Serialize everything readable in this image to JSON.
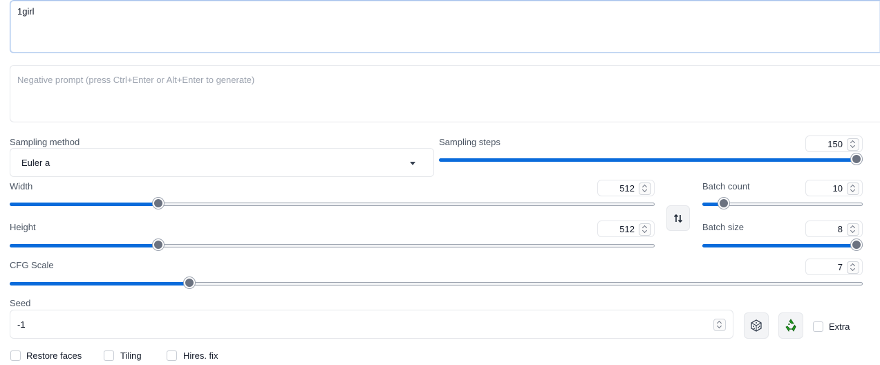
{
  "prompt": {
    "value": "1girl"
  },
  "negative_prompt": {
    "placeholder": "Negative prompt (press Ctrl+Enter or Alt+Enter to generate)"
  },
  "sampling_method": {
    "label": "Sampling method",
    "value": "Euler a"
  },
  "sampling_steps": {
    "label": "Sampling steps",
    "value": "150",
    "fraction": 1.0
  },
  "width": {
    "label": "Width",
    "value": "512",
    "fraction": 0.23
  },
  "height": {
    "label": "Height",
    "value": "512",
    "fraction": 0.23
  },
  "batch_count": {
    "label": "Batch count",
    "value": "10",
    "fraction": 0.13
  },
  "batch_size": {
    "label": "Batch size",
    "value": "8",
    "fraction": 1.0
  },
  "cfg_scale": {
    "label": "CFG Scale",
    "value": "7",
    "fraction": 0.21
  },
  "seed": {
    "label": "Seed",
    "value": "-1"
  },
  "extra": {
    "label": "Extra"
  },
  "checkboxes": {
    "restore_faces": "Restore faces",
    "tiling": "Tiling",
    "hires_fix": "Hires. fix"
  },
  "icons": {
    "swap": "swap-dimensions-icon",
    "dice": "dice-icon",
    "recycle": "recycle-icon"
  },
  "colors": {
    "accent": "#0a6bdb",
    "thumb": "#6b7280",
    "recycle": "#1f9d1f"
  }
}
